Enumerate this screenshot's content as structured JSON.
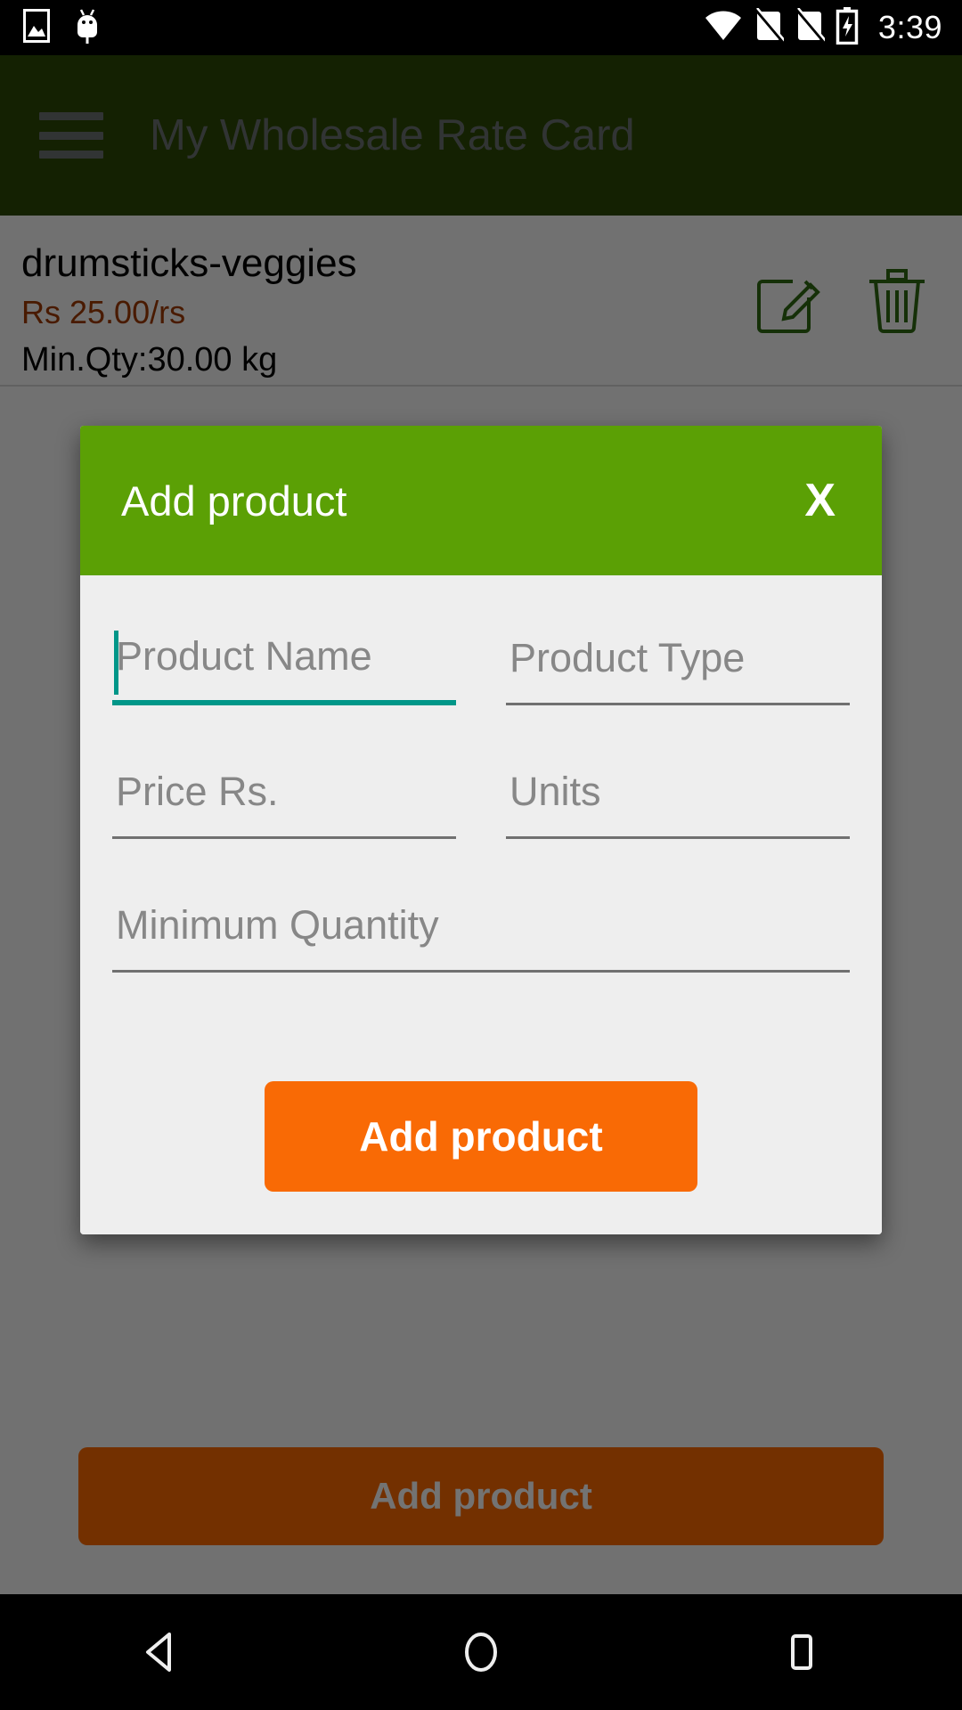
{
  "status_bar": {
    "time": "3:39",
    "icons": [
      "gallery-icon",
      "android-bug-icon",
      "wifi-icon",
      "no-sim-1-icon",
      "no-sim-2-icon",
      "battery-charging-icon"
    ]
  },
  "app_bar": {
    "title": "My Wholesale Rate Card",
    "menu_icon": "hamburger-icon",
    "background_color": "#2e4a05",
    "title_color": "#6e7473"
  },
  "product_list": {
    "items": [
      {
        "name": "drumsticks-veggies",
        "price": "Rs 25.00/rs",
        "min_qty": "Min.Qty:30.00 kg",
        "edit_icon": "edit-pencil-icon",
        "delete_icon": "trash-icon"
      }
    ]
  },
  "background_button": {
    "label": "Add product",
    "color": "#ff6a00"
  },
  "dialog": {
    "title": "Add product",
    "close_label": "X",
    "header_color": "#5ba005",
    "body_color": "#eeeeee",
    "fields": [
      {
        "placeholder": "Product Name",
        "value": "",
        "focused": true
      },
      {
        "placeholder": "Product Type",
        "value": "",
        "focused": false
      },
      {
        "placeholder": "Price Rs.",
        "value": "",
        "focused": false
      },
      {
        "placeholder": "Units",
        "value": "",
        "focused": false
      },
      {
        "placeholder": "Minimum Quantity",
        "value": "",
        "focused": false
      }
    ],
    "submit_label": "Add product",
    "submit_color": "#f96a05",
    "focus_color": "#009688"
  },
  "nav_bar": {
    "back_label": "back-triangle-icon",
    "home_label": "home-circle-icon",
    "recents_label": "recents-square-icon"
  }
}
